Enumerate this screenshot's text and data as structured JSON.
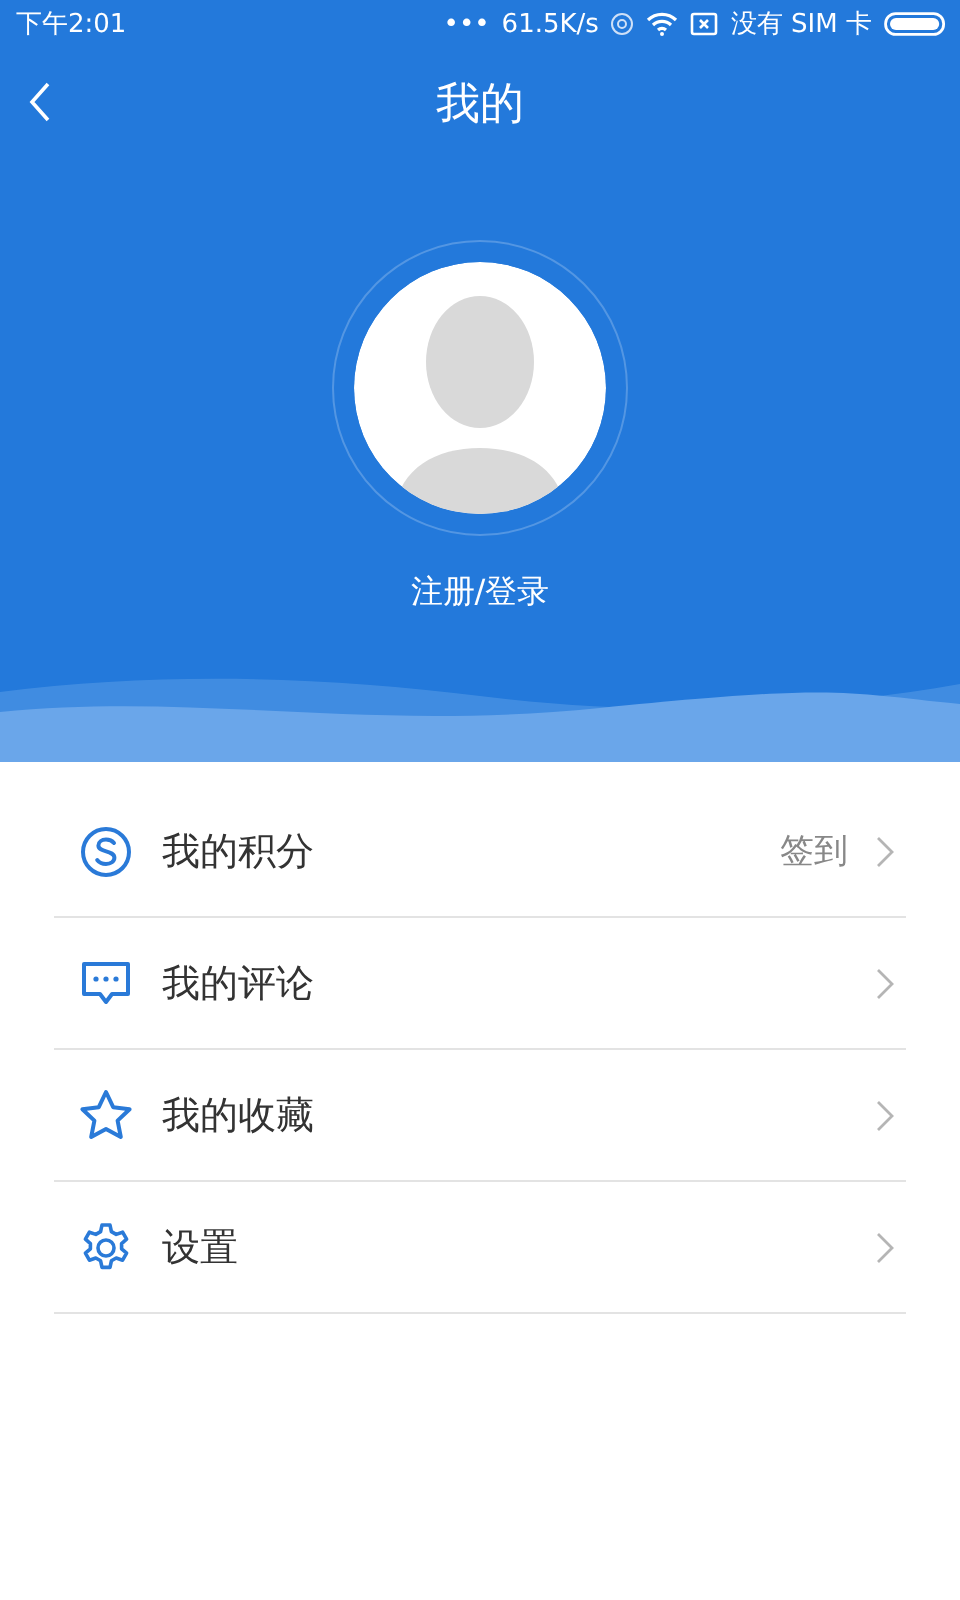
{
  "status_bar": {
    "time": "下午2:01",
    "dots": "•••",
    "speed": "61.5K/s",
    "carrier": "没有 SIM 卡"
  },
  "header": {
    "title": "我的"
  },
  "profile": {
    "login_label": "注册/登录"
  },
  "menu": [
    {
      "kind": "points",
      "label": "我的积分",
      "value": "签到"
    },
    {
      "kind": "comments",
      "label": "我的评论"
    },
    {
      "kind": "favorites",
      "label": "我的收藏"
    },
    {
      "kind": "settings",
      "label": "设置"
    }
  ]
}
